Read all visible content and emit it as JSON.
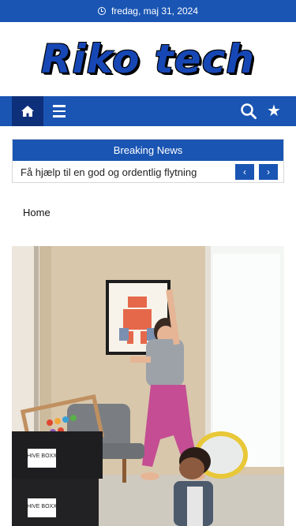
{
  "topbar": {
    "date": "fredag, maj 31, 2024",
    "icon": "clock-icon"
  },
  "logo": {
    "text": "Riko tech"
  },
  "nav": {
    "home_icon": "home-icon",
    "menu_icon": "hamburger-icon",
    "search_icon": "search-icon",
    "star_icon": "star-icon"
  },
  "breaking": {
    "title": "Breaking News",
    "headline": "Få hjælp til en god og ordentlig flytning",
    "prev": "‹",
    "next": "›"
  },
  "breadcrumb": {
    "home": "Home"
  },
  "hero": {
    "box_label_1": "HIVE BOXX",
    "box_label_2": "HIVE BOXX"
  },
  "colors": {
    "brand_blue": "#1a55b3",
    "dark_blue": "#0e2f7a"
  }
}
